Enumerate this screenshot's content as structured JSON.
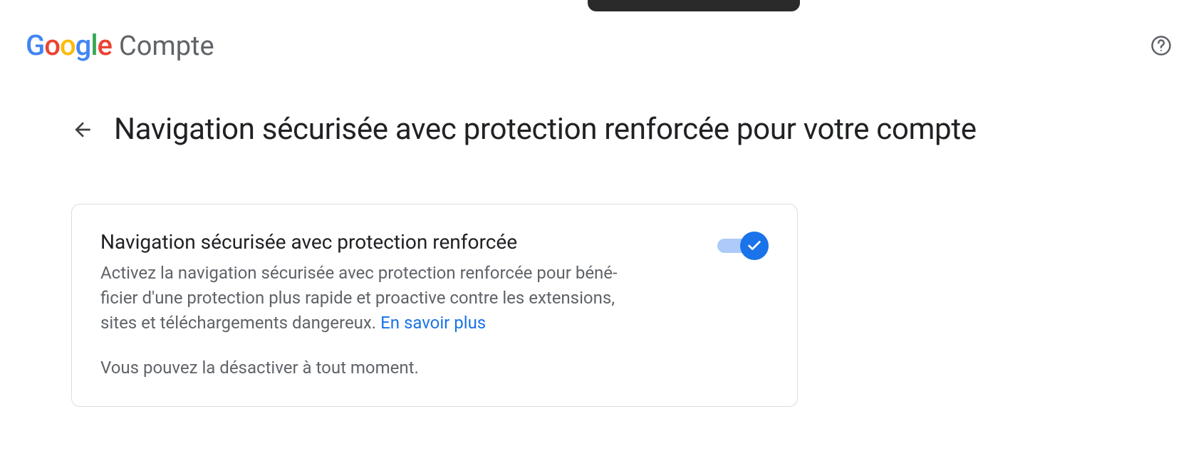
{
  "header": {
    "logo_letters": [
      "G",
      "o",
      "o",
      "g",
      "l",
      "e"
    ],
    "product": "Compte"
  },
  "page": {
    "title": "Navigation sécurisée avec protection renforcée pour votre compte"
  },
  "card": {
    "title": "Navigation sécurisée avec protection renforcée",
    "description": "Activez la navigation sécurisée avec protection renforcée pour béné­ficier d'une protection plus rapide et proactive contre les extensions, sites et téléchargements dangereux. ",
    "learn_more": "En savoir plus",
    "note": "Vous pouvez la désactiver à tout moment.",
    "toggle_on": true
  }
}
